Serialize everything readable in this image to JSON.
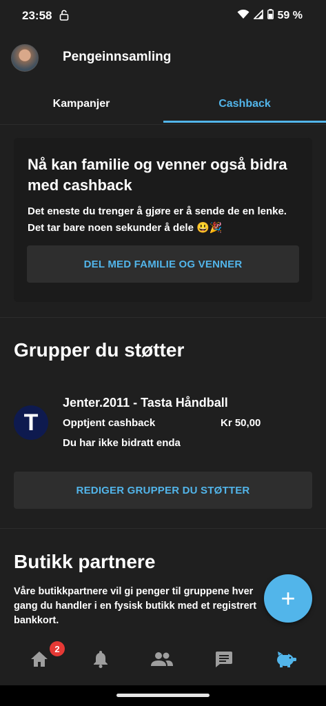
{
  "status_bar": {
    "time": "23:58",
    "battery": "59 %"
  },
  "app_bar": {
    "title": "Pengeinnsamling"
  },
  "tabs": [
    {
      "label": "Kampanjer"
    },
    {
      "label": "Cashback"
    }
  ],
  "share_card": {
    "title": "Nå kan familie og venner også bidra med cashback",
    "text": "Det eneste du trenger å gjøre er å sende de en lenke. Det tar bare noen sekunder å dele 😃🎉",
    "button": "DEL MED FAMILIE OG VENNER"
  },
  "groups": {
    "heading": "Grupper du støtter",
    "items": [
      {
        "logo_letter": "T",
        "name": "Jenter.2011 - Tasta Håndball",
        "cashback_label": "Opptjent cashback",
        "cashback_value": "Kr 50,00",
        "contribution": "Du har ikke bidratt enda"
      }
    ],
    "edit_button": "REDIGER GRUPPER DU STØTTER"
  },
  "partners": {
    "heading": "Butikk partnere",
    "text": "Våre butikkpartnere vil gi penger til gruppene hver gang du handler i en fysisk butikk med et registrert bankkort."
  },
  "fab": {
    "symbol": "+"
  },
  "bottom_nav": {
    "items": [
      {
        "icon": "home-icon",
        "badge": "2"
      },
      {
        "icon": "bell-icon"
      },
      {
        "icon": "people-icon"
      },
      {
        "icon": "chat-icon"
      },
      {
        "icon": "piggy-bank-icon",
        "active": true
      }
    ]
  },
  "colors": {
    "accent": "#52b5ea",
    "background": "#1f1f1f",
    "card": "#1b1b1b",
    "button": "#2e2e2e",
    "badge": "#e53935",
    "group_logo": "#0e1a4f"
  }
}
